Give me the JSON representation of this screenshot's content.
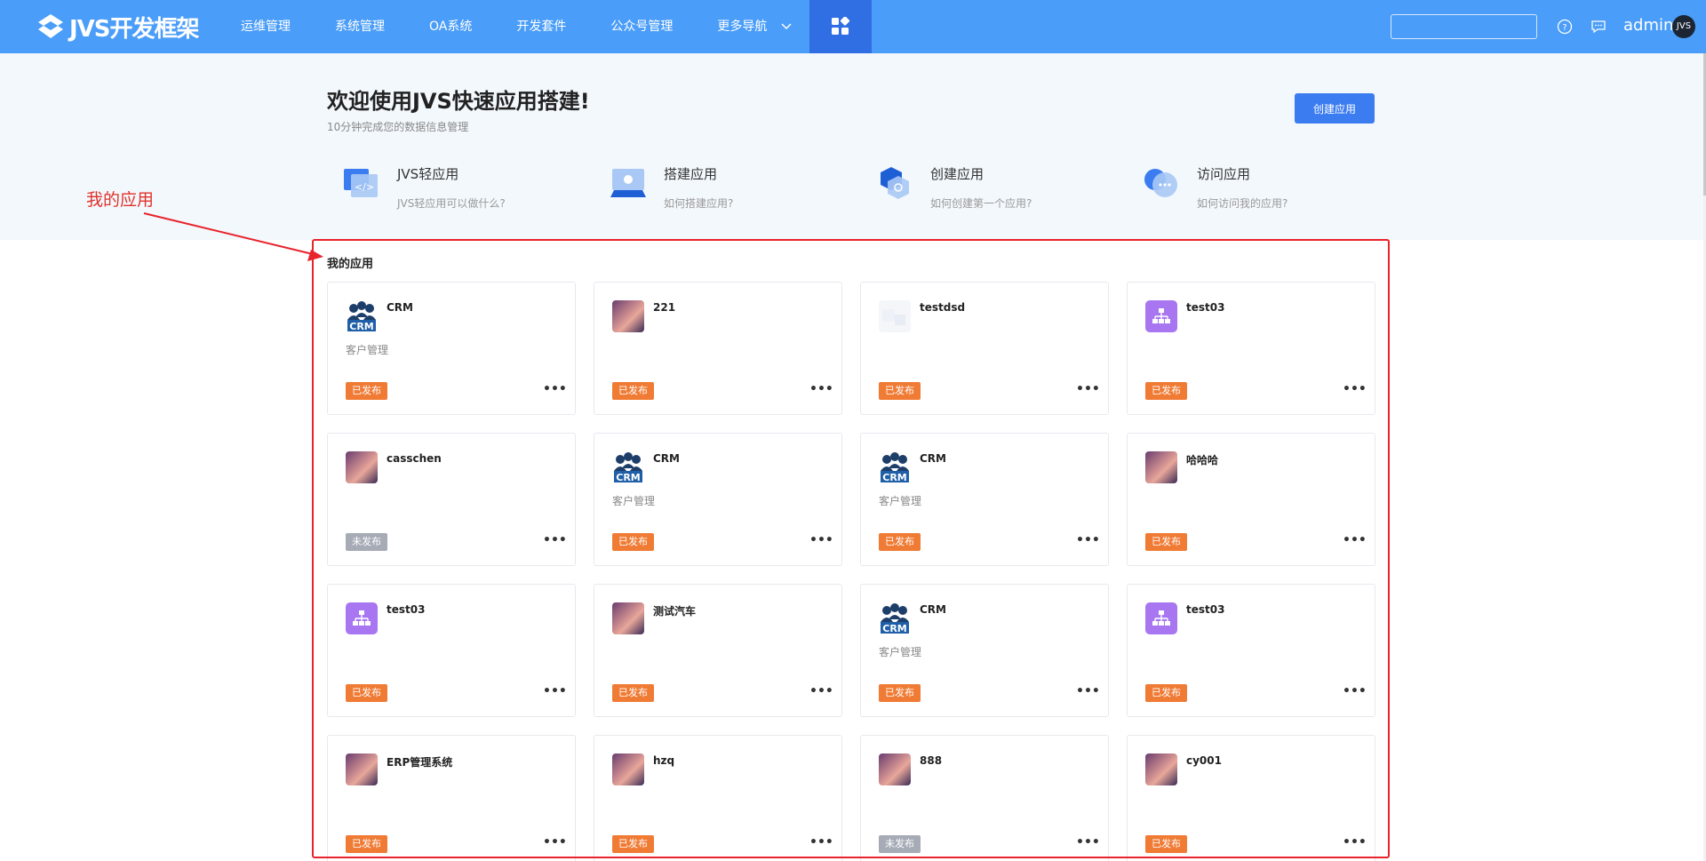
{
  "header": {
    "logo_text": "JVS开发框架",
    "nav": [
      "运维管理",
      "系统管理",
      "OA系统",
      "开发套件",
      "公众号管理",
      "更多导航"
    ],
    "search_placeholder": "",
    "user_name": "admin",
    "avatar_text": "JVS"
  },
  "hero": {
    "title": "欢迎使用JVS快速应用搭建!",
    "subtitle": "10分钟完成您的数据信息管理",
    "create_button": "创建应用",
    "quick_links": [
      {
        "title": "JVS轻应用",
        "desc": "JVS轻应用可以做什么?"
      },
      {
        "title": "搭建应用",
        "desc": "如何搭建应用?"
      },
      {
        "title": "创建应用",
        "desc": "如何创建第一个应用?"
      },
      {
        "title": "访问应用",
        "desc": "如何访问我的应用?"
      }
    ]
  },
  "annotation": {
    "label": "我的应用"
  },
  "apps_section": {
    "title": "我的应用",
    "more_label": "•••",
    "apps": [
      {
        "name": "CRM",
        "desc": "客户管理",
        "status": "已发布",
        "icon": "crm-people-icon"
      },
      {
        "name": "221",
        "desc": "",
        "status": "已发布",
        "icon": "gradient-image-icon"
      },
      {
        "name": "testdsd",
        "desc": "",
        "status": "已发布",
        "icon": "faint-image-icon"
      },
      {
        "name": "test03",
        "desc": "",
        "status": "已发布",
        "icon": "org-chart-icon"
      },
      {
        "name": "casschen",
        "desc": "",
        "status": "未发布",
        "icon": "gradient-image-icon"
      },
      {
        "name": "CRM",
        "desc": "客户管理",
        "status": "已发布",
        "icon": "crm-people-icon"
      },
      {
        "name": "CRM",
        "desc": "客户管理",
        "status": "已发布",
        "icon": "crm-people-icon"
      },
      {
        "name": "哈哈哈",
        "desc": "",
        "status": "已发布",
        "icon": "gradient-image-icon"
      },
      {
        "name": "test03",
        "desc": "",
        "status": "已发布",
        "icon": "org-chart-icon"
      },
      {
        "name": "测试汽车",
        "desc": "",
        "status": "已发布",
        "icon": "gradient-image-icon"
      },
      {
        "name": "CRM",
        "desc": "客户管理",
        "status": "已发布",
        "icon": "crm-people-icon"
      },
      {
        "name": "test03",
        "desc": "",
        "status": "已发布",
        "icon": "org-chart-icon"
      },
      {
        "name": "ERP管理系统",
        "desc": "",
        "status": "已发布",
        "icon": "gradient-image-icon"
      },
      {
        "name": "hzq",
        "desc": "",
        "status": "已发布",
        "icon": "gradient-image-icon"
      },
      {
        "name": "888",
        "desc": "",
        "status": "未发布",
        "icon": "gradient-image-icon"
      },
      {
        "name": "cy001",
        "desc": "",
        "status": "已发布",
        "icon": "gradient-image-icon"
      }
    ]
  },
  "colors": {
    "topbar": "#4a9df8",
    "apps_active": "#2f6fe3",
    "primary_button": "#3b7cf0",
    "published_badge": "#f07b35",
    "unpublished_badge": "#a6abb6",
    "annotation_red": "#e8232b",
    "hero_bg": "#f3f8fd"
  }
}
